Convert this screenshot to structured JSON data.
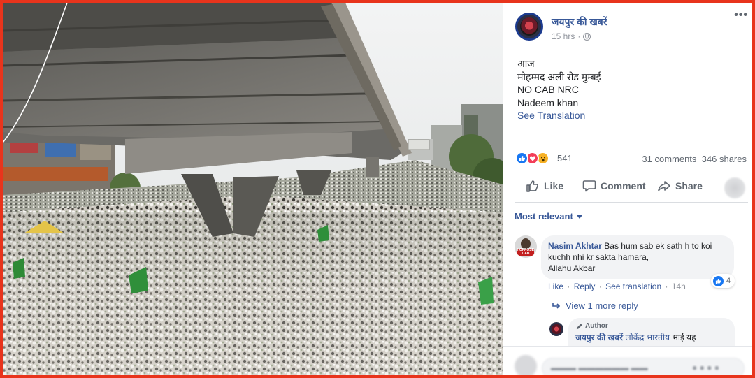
{
  "post": {
    "page_name": "जयपुर की खबरें",
    "timestamp": "15 hrs",
    "audience_icon": "globe-icon",
    "text_lines": [
      "आज",
      "मोहम्मद अली रोड मुम्बई",
      "NO CAB NRC",
      "Nadeem khan"
    ],
    "see_translation": "See Translation",
    "reaction_count": "541",
    "comments_count": "31 comments",
    "shares_count": "346 shares"
  },
  "actions": {
    "like": "Like",
    "comment": "Comment",
    "share": "Share"
  },
  "comments": {
    "sort_label": "Most relevant",
    "first": {
      "author": "Nasim Akhtar",
      "text": "Bas hum sab ek sath h to koi kuchh nhi kr sakta hamara,",
      "text2": "Allahu Akbar",
      "avatar_tag": "I OPPOSE CAB",
      "like": "Like",
      "reply": "Reply",
      "see_translation": "See translation",
      "time": "14h",
      "reaction_count": "4"
    },
    "view_more": "View 1 more reply",
    "reply": {
      "badge": "Author",
      "author": "जयपुर की खबरें",
      "mention": "लोकेंद्र भारतीय",
      "text": "भाई यह"
    }
  },
  "colors": {
    "frame_border": "#e8341c",
    "link_blue": "#385898",
    "like_blue": "#1877f2",
    "love_red": "#f33e58",
    "wow_yellow": "#f7b125",
    "bubble_bg": "#f2f3f5"
  }
}
